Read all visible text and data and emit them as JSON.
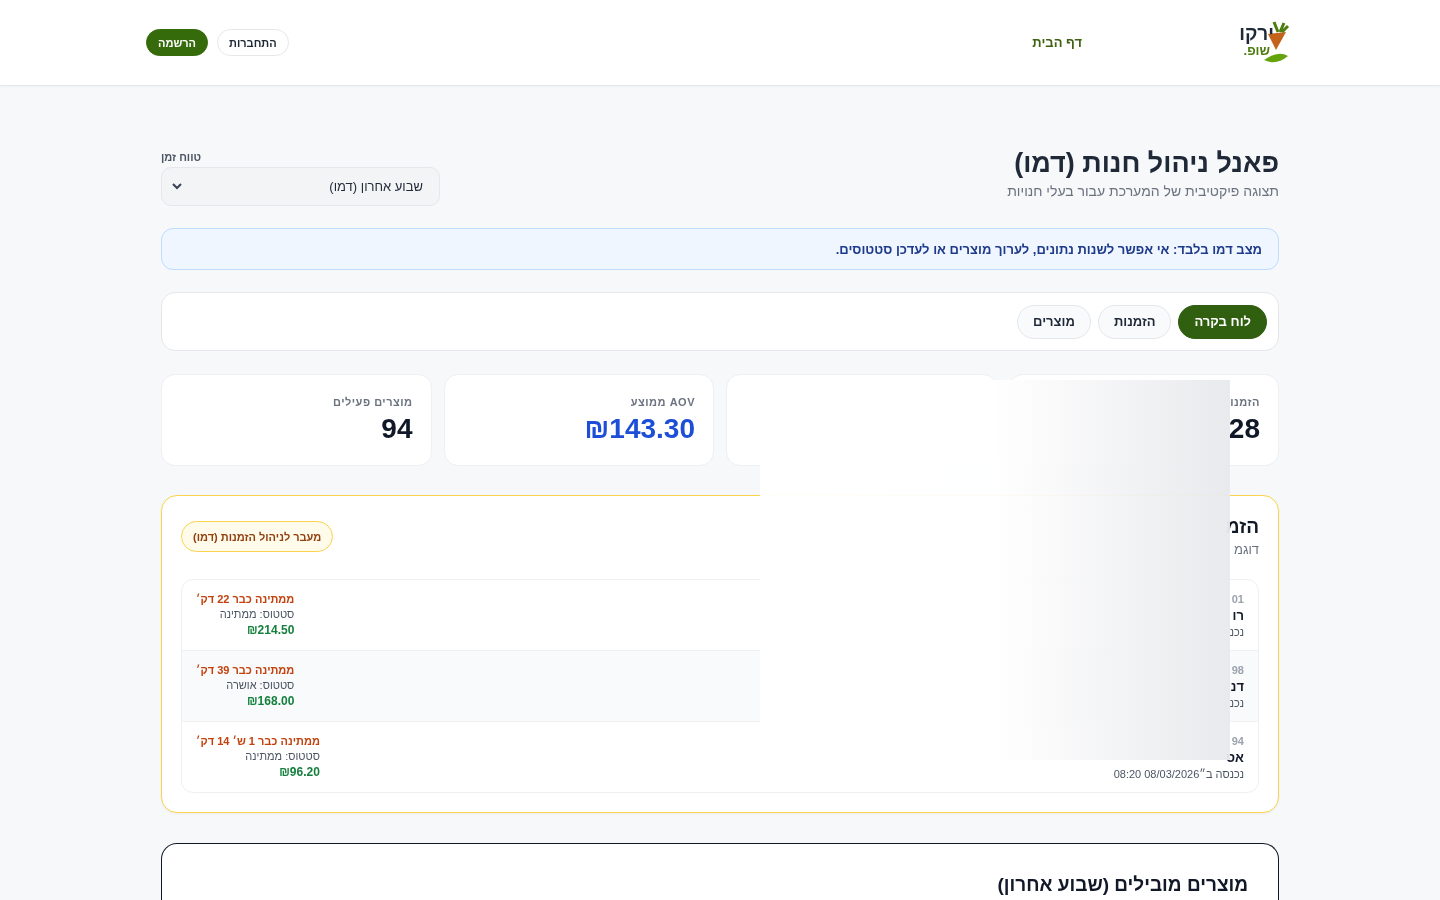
{
  "header": {
    "logo": {
      "top": "ירקו",
      "bottom": "שופ."
    },
    "nav": [
      {
        "label": "דף הבית",
        "selected": true
      }
    ],
    "buttons": [
      {
        "label": "התחברות",
        "kind": "outline"
      },
      {
        "label": "הרשמה",
        "kind": "primary"
      }
    ]
  },
  "page": {
    "title": "פאנל ניהול חנות (דמו)",
    "subtitle": "תצוגה פיקטיבית של המערכת עבור בעלי חנויות",
    "time_range": {
      "label": "טווח זמן",
      "value": "שבוע אחרון (דמו)"
    }
  },
  "notice": "מצב דמו בלבד: אי אפשר לשנות נתונים, לערוך מוצרים או לעדכן סטטוסים.",
  "tabs": [
    {
      "label": "לוח בקרה",
      "selected": true
    },
    {
      "label": "הזמנות",
      "selected": false
    },
    {
      "label": "מוצרים",
      "selected": false
    }
  ],
  "stats": [
    {
      "label": "הזמנו",
      "value": "28",
      "color": "#111827"
    },
    {
      "label": "AOV ממוצע",
      "value": "₪143.30",
      "color": "#1d4ed8"
    },
    {
      "label": "מוצרים פעילים",
      "value": "94",
      "color": "#111827"
    }
  ],
  "orders": {
    "title": "הזמ",
    "subtitle": "דוגמ",
    "action": "מעבר לניהול הזמנות (דמו)",
    "rows": [
      {
        "number": "01",
        "customer": "רו",
        "placed": "נכנ",
        "wait": "ממתינה כבר 22 דק׳",
        "status": "סטטוס: ממתינה",
        "total": "₪214.50"
      },
      {
        "number": "98",
        "customer": "דנ",
        "placed": "נכנ",
        "wait": "ממתינה כבר 39 דק׳",
        "status": "סטטוס: אושרה",
        "total": "₪168.00"
      },
      {
        "number": "94",
        "customer": "אס",
        "placed": "נכנסה ב״08/03/2026 08:20",
        "wait": "ממתינה כבר 1 ש׳ 14 דק׳",
        "status": "סטטוס: ממתינה",
        "total": "₪96.20"
      }
    ]
  },
  "products": {
    "title": "מוצרים מובילים (שבוע אחרון)"
  }
}
